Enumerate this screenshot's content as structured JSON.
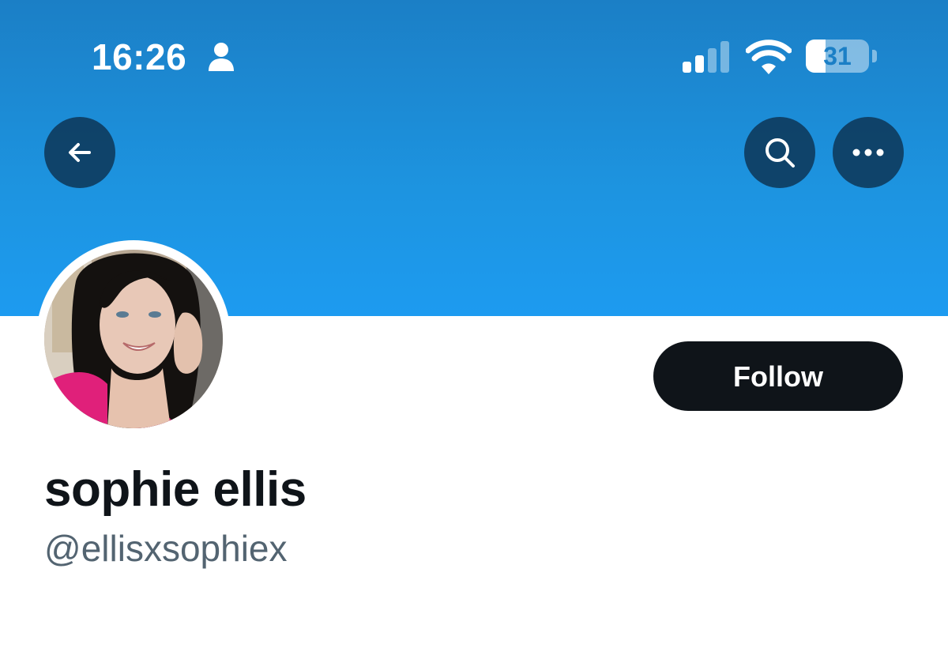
{
  "status_bar": {
    "time": "16:26",
    "battery_level": "31",
    "battery_fraction": 0.31,
    "signal_bars_active": 2,
    "signal_bars_total": 4
  },
  "nav": {
    "back_icon": "arrow-left-icon",
    "search_icon": "search-icon",
    "more_icon": "more-horizontal-icon"
  },
  "profile": {
    "display_name": "sophie ellis",
    "handle": "@ellisxsophiex",
    "follow_label": "Follow"
  },
  "colors": {
    "banner_top": "#1b7fc6",
    "banner_bottom": "#1d9bf0",
    "follow_button": "#0f1419",
    "handle_text": "#536471"
  }
}
